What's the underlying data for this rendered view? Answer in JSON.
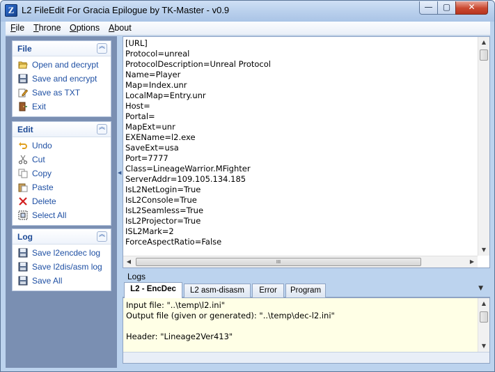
{
  "window": {
    "title": "L2 FileEdit For Gracia Epilogue by TK-Master - v0.9",
    "app_icon_glyph": "Z",
    "minimize_glyph": "—",
    "maximize_glyph": "▢",
    "close_glyph": "✕"
  },
  "menubar": [
    {
      "first": "F",
      "rest": "ile"
    },
    {
      "first": "T",
      "rest": "hrone"
    },
    {
      "first": "O",
      "rest": "ptions"
    },
    {
      "first": "A",
      "rest": "bout"
    }
  ],
  "sidebar": {
    "collapse_glyph": "︽",
    "groups": [
      {
        "title": "File",
        "items": [
          {
            "label": "Open and decrypt",
            "icon": "open-folder-icon"
          },
          {
            "label": "Save and encrypt",
            "icon": "floppy-icon"
          },
          {
            "label": "Save as TXT",
            "icon": "edit-pencil-icon"
          },
          {
            "label": "Exit",
            "icon": "exit-door-icon"
          }
        ]
      },
      {
        "title": "Edit",
        "items": [
          {
            "label": "Undo",
            "icon": "undo-icon"
          },
          {
            "label": "Cut",
            "icon": "scissors-icon"
          },
          {
            "label": "Copy",
            "icon": "copy-icon"
          },
          {
            "label": "Paste",
            "icon": "paste-icon"
          },
          {
            "label": "Delete",
            "icon": "delete-x-icon"
          },
          {
            "label": "Select All",
            "icon": "select-all-icon"
          }
        ]
      },
      {
        "title": "Log",
        "items": [
          {
            "label": "Save l2encdec log",
            "icon": "floppy-icon"
          },
          {
            "label": "Save l2dis/asm log",
            "icon": "floppy-icon"
          },
          {
            "label": "Save All",
            "icon": "floppy-icon"
          }
        ]
      }
    ]
  },
  "editor": {
    "lines": [
      "[URL]",
      "Protocol=unreal",
      "ProtocolDescription=Unreal Protocol",
      "Name=Player",
      "Map=Index.unr",
      "LocalMap=Entry.unr",
      "Host=",
      "Portal=",
      "MapExt=unr",
      "EXEName=l2.exe",
      "SaveExt=usa",
      "Port=7777",
      "Class=LineageWarrior.MFighter",
      "ServerAddr=109.105.134.185",
      "IsL2NetLogin=True",
      "IsL2Console=True",
      "IsL2Seamless=True",
      "IsL2Projector=True",
      "ISL2Mark=2",
      "ForceAspectRatio=False"
    ],
    "scroll_up": "▲",
    "scroll_down": "▼",
    "scroll_left": "◀",
    "scroll_right": "▶",
    "thumb_grip": "III"
  },
  "logs": {
    "label": "Logs",
    "tabs": [
      "L2 - EncDec",
      "L2 asm-disasm",
      "Error",
      "Program"
    ],
    "active_tab": "L2 - EncDec",
    "tab_menu_glyph": "▼",
    "lines": [
      "Input file: \"..\\temp\\l2.ini\"",
      "Output file (given or generated): \"..\\temp\\dec-l2.ini\"",
      "",
      "Header: \"Lineage2Ver413\""
    ]
  },
  "colors": {
    "frame": "#bcd3ee",
    "sidebar_bg": "#7a8fb2",
    "link_text": "#1e4fa3",
    "log_bg": "#ffffe6",
    "close_red": "#c9472f"
  }
}
